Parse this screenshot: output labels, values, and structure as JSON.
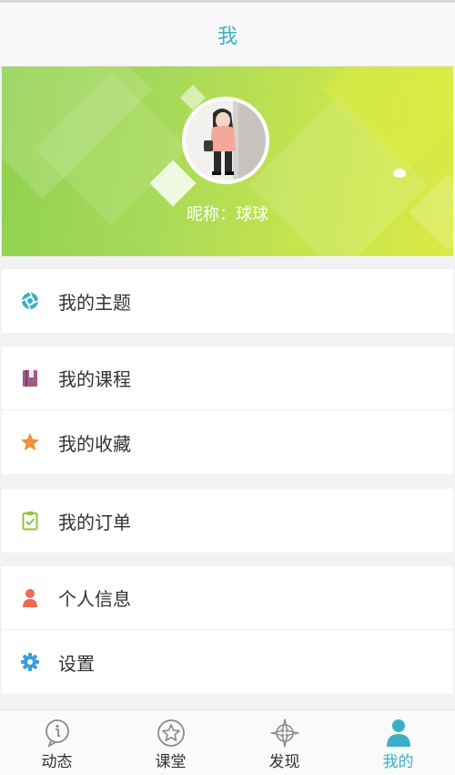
{
  "header": {
    "title": "我"
  },
  "profile": {
    "nickname": "昵称：球球"
  },
  "menu_groups": [
    [
      {
        "label": "我的主题",
        "icon": "aperture-icon",
        "color": "#3bb0c4"
      }
    ],
    [
      {
        "label": "我的课程",
        "icon": "book-icon",
        "color": "#a35a8a"
      },
      {
        "label": "我的收藏",
        "icon": "star-icon",
        "color": "#f0913b"
      }
    ],
    [
      {
        "label": "我的订单",
        "icon": "clipboard-check-icon",
        "color": "#8cc63e"
      }
    ],
    [
      {
        "label": "个人信息",
        "icon": "person-icon",
        "color": "#ee6b4d"
      },
      {
        "label": "设置",
        "icon": "gear-icon",
        "color": "#3a9fdc"
      }
    ]
  ],
  "tabbar": {
    "tabs": [
      {
        "label": "动态",
        "icon": "info-bubble-icon",
        "active": false
      },
      {
        "label": "课堂",
        "icon": "star-circle-icon",
        "active": false
      },
      {
        "label": "发现",
        "icon": "compass-icon",
        "active": false
      },
      {
        "label": "我的",
        "icon": "user-icon",
        "active": true
      }
    ]
  },
  "colors": {
    "accent": "#3bb0c4",
    "text": "#333333",
    "background": "#f2f2f4"
  }
}
